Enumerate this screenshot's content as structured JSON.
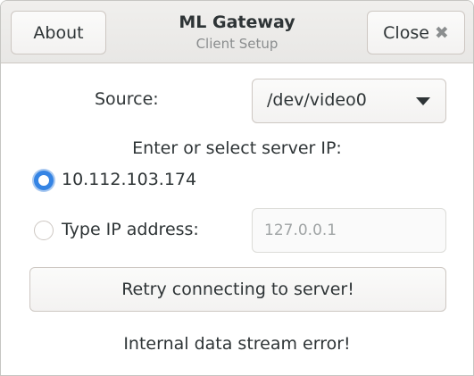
{
  "header": {
    "title": "ML Gateway",
    "subtitle": "Client Setup",
    "about_label": "About",
    "close_label": "Close",
    "close_icon": "✖"
  },
  "source": {
    "label": "Source:",
    "selected": "/dev/video0"
  },
  "server": {
    "prompt": "Enter or select server IP:",
    "options": [
      {
        "label": "10.112.103.174",
        "checked": true
      },
      {
        "label": "Type IP address:",
        "checked": false
      }
    ],
    "ip_placeholder": "127.0.0.1"
  },
  "retry_label": "Retry connecting to server!",
  "status": "Internal data stream error!",
  "colors": {
    "accent": "#3584e4",
    "text": "#2e3436",
    "dim_text": "#8a8d8e"
  }
}
